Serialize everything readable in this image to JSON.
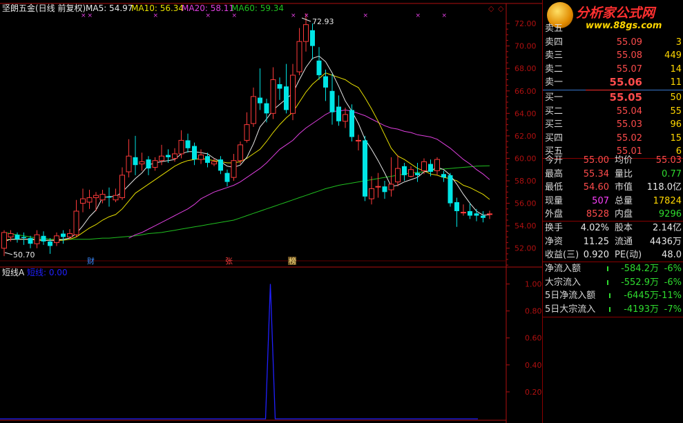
{
  "header": {
    "stock_name": "坚朗五金(日线 前复权)",
    "ma5": "MA5: 54.97",
    "ma10": "MA10: 56.34",
    "ma20": "MA20: 58.11",
    "ma60": "MA60: 59.34"
  },
  "colors": {
    "up": "#ff3a3a",
    "down": "#00e5e5",
    "ma5": "#e8e8e8",
    "ma10": "#e8e000",
    "ma20": "#e040e0",
    "ma60": "#20c020",
    "axis": "#b01010",
    "indicator": "#2020ff"
  },
  "price_axis": {
    "ticks": [
      "72.00",
      "70.00",
      "68.00",
      "66.00",
      "64.00",
      "62.00",
      "60.00",
      "58.00",
      "56.00",
      "54.00",
      "52.00"
    ]
  },
  "annotations": {
    "high_label": "72.93",
    "low_label": "50.70",
    "marker_cai": "财",
    "marker_zhang": "张",
    "marker_bang": "榜"
  },
  "indicator": {
    "name": "短线A",
    "series_label": "短线: 0.00",
    "ticks": [
      "1.00",
      "0.80",
      "0.60",
      "0.40",
      "0.20"
    ]
  },
  "banner": {
    "line1": "分析家公式网",
    "line2": "www.88gs.com"
  },
  "order_book": {
    "sell": [
      {
        "label": "卖五",
        "price": "",
        "vol": ""
      },
      {
        "label": "卖四",
        "price": "55.09",
        "vol": "3"
      },
      {
        "label": "卖三",
        "price": "55.08",
        "vol": "449"
      },
      {
        "label": "卖二",
        "price": "55.07",
        "vol": "14"
      },
      {
        "label": "卖一",
        "price": "55.06",
        "vol": "11"
      }
    ],
    "buy": [
      {
        "label": "买一",
        "price": "55.05",
        "vol": "50"
      },
      {
        "label": "买二",
        "price": "55.04",
        "vol": "55"
      },
      {
        "label": "买三",
        "price": "55.03",
        "vol": "96"
      },
      {
        "label": "买四",
        "price": "55.02",
        "vol": "15"
      },
      {
        "label": "买五",
        "price": "55.01",
        "vol": "6"
      }
    ]
  },
  "quote": [
    {
      "l1": "今开",
      "v1": "55.00",
      "l2": "均价",
      "v2": "55.03"
    },
    {
      "l1": "最高",
      "v1": "55.34",
      "l2": "量比",
      "v2": "0.77"
    },
    {
      "l1": "最低",
      "v1": "54.60",
      "l2": "市值",
      "v2": "118.0亿"
    },
    {
      "l1": "现量",
      "v1": "507",
      "l2": "总量",
      "v2": "17824"
    },
    {
      "l1": "外盘",
      "v1": "8528",
      "l2": "内盘",
      "v2": "9296"
    }
  ],
  "fundamentals": [
    {
      "l1": "换手",
      "v1": "4.02%",
      "l2": "股本",
      "v2": "2.14亿"
    },
    {
      "l1": "净资",
      "v1": "11.25",
      "l2": "流通",
      "v2": "4436万"
    },
    {
      "l1": "收益(三)",
      "v1": "0.920",
      "l2": "PE(动)",
      "v2": "48.0"
    }
  ],
  "fund_flow": [
    {
      "label": "净流入额",
      "v1": "-584.2万",
      "v2": "-6%"
    },
    {
      "label": "大宗流入",
      "v1": "-552.9万",
      "v2": "-6%"
    },
    {
      "label": "5日净流入额",
      "v1": "-6445万",
      "v2": "-11%"
    },
    {
      "label": "5日大宗流入",
      "v1": "-4193万",
      "v2": "-7%"
    }
  ],
  "chart_data": {
    "type": "candlestick",
    "ylim": [
      51,
      73.6
    ],
    "candles": [
      [
        52.0,
        53.4,
        51.3,
        53.6
      ],
      [
        53.0,
        53.3,
        52.6,
        53.6
      ],
      [
        53.2,
        52.8,
        52.5,
        53.4
      ],
      [
        53.0,
        52.9,
        52.3,
        53.4
      ],
      [
        52.9,
        52.4,
        52.0,
        53.1
      ],
      [
        52.4,
        53.2,
        52.0,
        53.6
      ],
      [
        53.1,
        52.6,
        52.3,
        53.5
      ],
      [
        52.6,
        52.2,
        51.5,
        52.9
      ],
      [
        52.5,
        53.1,
        52.2,
        53.4
      ],
      [
        53.3,
        53.0,
        52.4,
        53.6
      ],
      [
        53.0,
        53.3,
        52.8,
        53.7
      ],
      [
        53.2,
        55.3,
        53.0,
        56.3
      ],
      [
        56.0,
        56.4,
        55.2,
        57.3
      ],
      [
        56.1,
        56.5,
        55.5,
        57.2
      ],
      [
        56.5,
        56.7,
        55.3,
        57.0
      ],
      [
        56.3,
        56.8,
        56.0,
        57.2
      ],
      [
        56.6,
        56.5,
        55.7,
        57.4
      ],
      [
        56.3,
        56.7,
        56.1,
        57.3
      ],
      [
        56.5,
        58.5,
        56.3,
        59.2
      ],
      [
        58.8,
        60.2,
        58.3,
        61.7
      ],
      [
        60.1,
        59.4,
        58.5,
        62.0
      ],
      [
        59.5,
        59.7,
        58.9,
        60.5
      ],
      [
        59.9,
        59.1,
        58.5,
        60.2
      ],
      [
        59.2,
        59.8,
        58.9,
        60.1
      ],
      [
        59.8,
        60.2,
        59.4,
        61.2
      ],
      [
        60.3,
        60.1,
        59.6,
        60.8
      ],
      [
        60.0,
        60.4,
        59.7,
        60.9
      ],
      [
        60.4,
        61.6,
        60.0,
        62.5
      ],
      [
        61.6,
        60.9,
        60.5,
        62.2
      ],
      [
        61.1,
        59.9,
        59.4,
        61.4
      ],
      [
        59.9,
        60.3,
        59.5,
        60.8
      ],
      [
        60.2,
        59.6,
        59.2,
        60.5
      ],
      [
        59.5,
        59.7,
        59.3,
        60.0
      ],
      [
        59.9,
        58.9,
        58.6,
        60.2
      ],
      [
        58.7,
        57.9,
        57.5,
        59.0
      ],
      [
        58.3,
        59.8,
        58.0,
        60.4
      ],
      [
        59.8,
        61.2,
        59.5,
        61.5
      ],
      [
        61.6,
        63.0,
        61.4,
        64.1
      ],
      [
        63.1,
        65.5,
        62.8,
        66.3
      ],
      [
        65.4,
        64.9,
        64.3,
        68.0
      ],
      [
        64.9,
        64.0,
        63.2,
        65.3
      ],
      [
        64.0,
        67.0,
        63.5,
        68.1
      ],
      [
        66.6,
        66.2,
        65.2,
        67.2
      ],
      [
        66.4,
        64.3,
        64.0,
        68.4
      ],
      [
        64.0,
        67.4,
        63.4,
        68.4
      ],
      [
        67.7,
        70.4,
        67.4,
        71.6
      ],
      [
        70.4,
        71.9,
        69.5,
        72.9
      ],
      [
        71.4,
        70.0,
        68.8,
        72.0
      ],
      [
        68.7,
        67.4,
        67.0,
        69.9
      ],
      [
        67.3,
        66.3,
        65.1,
        67.9
      ],
      [
        66.0,
        64.1,
        63.0,
        67.5
      ],
      [
        64.6,
        63.3,
        62.9,
        65.6
      ],
      [
        63.3,
        63.9,
        62.7,
        64.5
      ],
      [
        64.3,
        61.9,
        61.5,
        64.8
      ],
      [
        61.6,
        61.6,
        60.7,
        62.1
      ],
      [
        61.6,
        56.6,
        56.2,
        62.0
      ],
      [
        56.4,
        57.3,
        55.9,
        58.4
      ],
      [
        57.5,
        57.5,
        56.5,
        58.7
      ],
      [
        57.5,
        57.0,
        56.4,
        58.0
      ],
      [
        57.2,
        57.7,
        56.6,
        60.1
      ],
      [
        57.9,
        59.1,
        57.5,
        60.3
      ],
      [
        59.3,
        58.5,
        58.0,
        59.6
      ],
      [
        58.4,
        59.0,
        58.3,
        59.3
      ],
      [
        58.7,
        58.5,
        57.9,
        59.6
      ],
      [
        58.9,
        59.7,
        58.6,
        60.0
      ],
      [
        59.5,
        58.8,
        58.4,
        59.9
      ],
      [
        58.9,
        59.9,
        58.5,
        60.1
      ],
      [
        58.6,
        58.3,
        57.9,
        58.9
      ],
      [
        58.5,
        56.0,
        55.7,
        58.7
      ],
      [
        56.1,
        55.3,
        53.9,
        56.5
      ],
      [
        55.2,
        55.2,
        54.9,
        55.9
      ],
      [
        55.3,
        54.9,
        54.6,
        56.0
      ],
      [
        55.1,
        54.9,
        54.4,
        55.5
      ],
      [
        54.9,
        54.7,
        54.3,
        55.3
      ],
      [
        55.0,
        55.06,
        54.6,
        55.34
      ]
    ],
    "ma5": [
      52.6,
      52.8,
      52.8,
      52.8,
      52.8,
      52.8,
      52.7,
      52.7,
      52.7,
      52.8,
      52.9,
      53.3,
      54.0,
      54.8,
      55.4,
      56.5,
      56.6,
      56.6,
      57.0,
      57.6,
      58.2,
      58.7,
      59.4,
      59.6,
      59.7,
      59.8,
      59.9,
      60.4,
      60.6,
      60.6,
      60.5,
      60.4,
      60.0,
      59.7,
      59.3,
      59.2,
      59.4,
      60.1,
      61.3,
      62.8,
      63.5,
      64.3,
      64.8,
      65.3,
      65.8,
      67.0,
      68.1,
      68.9,
      69.1,
      68.6,
      67.6,
      66.4,
      65.1,
      64.2,
      63.1,
      61.7,
      60.8,
      59.8,
      58.7,
      57.5,
      57.6,
      57.9,
      58.1,
      58.3,
      58.8,
      58.9,
      59.2,
      59.0,
      58.5,
      57.7,
      56.8,
      56.0,
      55.3,
      54.95,
      54.97
    ],
    "ma10": [
      52.7,
      52.8,
      52.8,
      52.8,
      52.8,
      52.7,
      52.7,
      52.7,
      52.7,
      52.7,
      52.8,
      53.0,
      53.4,
      53.8,
      54.1,
      54.5,
      54.8,
      55.0,
      55.5,
      56.2,
      56.9,
      57.3,
      57.7,
      58.1,
      58.5,
      58.9,
      59.3,
      59.6,
      59.8,
      59.9,
      60.0,
      59.9,
      59.8,
      59.7,
      59.6,
      59.6,
      59.7,
      60.0,
      60.4,
      60.8,
      61.5,
      62.3,
      63.0,
      63.6,
      64.1,
      65.0,
      65.9,
      66.6,
      67.1,
      67.6,
      67.4,
      67.2,
      67.0,
      66.6,
      66.3,
      65.4,
      64.4,
      63.3,
      62.1,
      60.9,
      60.2,
      59.9,
      59.5,
      59.1,
      58.9,
      58.6,
      58.5,
      58.3,
      58.2,
      58.0,
      57.6,
      57.4,
      57.1,
      56.8,
      56.34
    ],
    "ma20": [
      null,
      null,
      null,
      null,
      null,
      null,
      null,
      null,
      null,
      null,
      null,
      null,
      null,
      null,
      null,
      null,
      null,
      null,
      null,
      52.9,
      53.2,
      53.4,
      53.7,
      54.0,
      54.3,
      54.6,
      54.9,
      55.2,
      55.5,
      55.9,
      56.4,
      56.7,
      57.0,
      57.2,
      57.4,
      57.6,
      57.9,
      58.3,
      58.7,
      59.1,
      59.6,
      60.2,
      60.8,
      61.2,
      61.6,
      62.2,
      62.7,
      63.1,
      63.5,
      63.9,
      64.2,
      64.2,
      64.3,
      64.2,
      64.0,
      63.8,
      63.5,
      63.2,
      62.9,
      62.7,
      62.6,
      62.4,
      62.3,
      62.1,
      62.0,
      61.9,
      61.7,
      61.3,
      60.9,
      60.4,
      59.9,
      59.5,
      59.0,
      58.6,
      58.11
    ],
    "ma60": [
      53.4,
      53.3,
      53.2,
      53.1,
      53.0,
      52.9,
      52.9,
      52.8,
      52.8,
      52.8,
      52.8,
      52.8,
      52.8,
      52.8,
      52.85,
      52.9,
      52.9,
      52.95,
      53.0,
      53.05,
      53.1,
      53.2,
      53.3,
      53.35,
      53.4,
      53.5,
      53.6,
      53.7,
      53.8,
      53.9,
      54.0,
      54.1,
      54.2,
      54.3,
      54.4,
      54.5,
      54.7,
      54.9,
      55.1,
      55.3,
      55.5,
      55.7,
      55.9,
      56.1,
      56.3,
      56.5,
      56.7,
      56.9,
      57.1,
      57.3,
      57.45,
      57.6,
      57.7,
      57.8,
      57.9,
      58.0,
      58.1,
      58.2,
      58.3,
      58.4,
      58.5,
      58.6,
      58.7,
      58.75,
      58.8,
      58.9,
      59.0,
      59.05,
      59.1,
      59.15,
      59.2,
      59.25,
      59.3,
      59.32,
      59.34
    ],
    "indicator_values": [
      0,
      0,
      0,
      0,
      0,
      0,
      0,
      0,
      0,
      0,
      0,
      0,
      0,
      0,
      0,
      0,
      0,
      0,
      0,
      0,
      0,
      0,
      0,
      0,
      0,
      0,
      0,
      0,
      0,
      0,
      0,
      0,
      0,
      0,
      0,
      0,
      0,
      0,
      0,
      0,
      0,
      1,
      0,
      0,
      0,
      0,
      0,
      0,
      0,
      0,
      0,
      0,
      0,
      0,
      0,
      0,
      0,
      0,
      0,
      0,
      0,
      0,
      0,
      0,
      0,
      0,
      0,
      0,
      0,
      0,
      0,
      0,
      0,
      0,
      0
    ],
    "indicator_ylim": [
      0,
      1.1
    ]
  }
}
